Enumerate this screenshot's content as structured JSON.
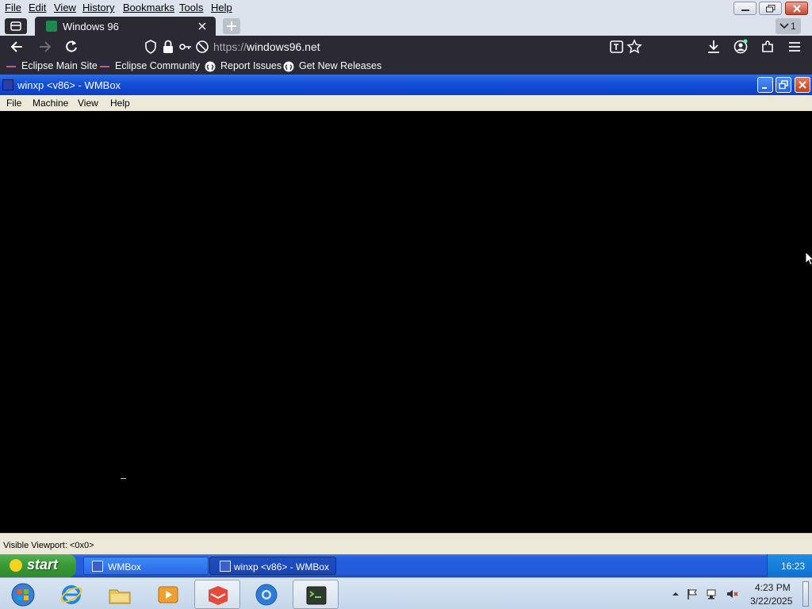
{
  "firefox_menu": {
    "items": [
      "File",
      "Edit",
      "View",
      "History",
      "Bookmarks",
      "Tools",
      "Help"
    ]
  },
  "tab": {
    "title": "Windows 96",
    "all_tabs_count": "1"
  },
  "address_bar": {
    "scheme": "https://",
    "host": "windows96.net"
  },
  "bookmarks": [
    {
      "label": "Eclipse Main Site",
      "icon": "eclipse-icon"
    },
    {
      "label": "Eclipse Community",
      "icon": "eclipse-icon"
    },
    {
      "label": "Report Issues",
      "icon": "github-icon"
    },
    {
      "label": "Get New Releases",
      "icon": "github-icon"
    }
  ],
  "vm_window": {
    "title": "winxp <v86> - WMBox",
    "menu": [
      "File",
      "Machine",
      "View",
      "Help"
    ],
    "status": "Visible Viewport: <0x0>"
  },
  "xp_taskbar": {
    "start_label": "start",
    "tasks": [
      {
        "label": "WMBox"
      },
      {
        "label": "winxp <v86> - WMBox"
      }
    ],
    "clock": "16:23"
  },
  "host_taskbar": {
    "pinned": [
      "windows-orb",
      "internet-explorer",
      "file-explorer",
      "media-player",
      "gitkraken-app",
      "chromium-app",
      "terminal-app"
    ],
    "clock_time": "4:23 PM",
    "clock_date": "3/22/2025"
  },
  "colors": {
    "firefox_dark": "#2b2a33",
    "xp_blue": "#235bd8",
    "xp_green": "#3a9a37",
    "vm_menu_bg": "#ece9d8"
  }
}
